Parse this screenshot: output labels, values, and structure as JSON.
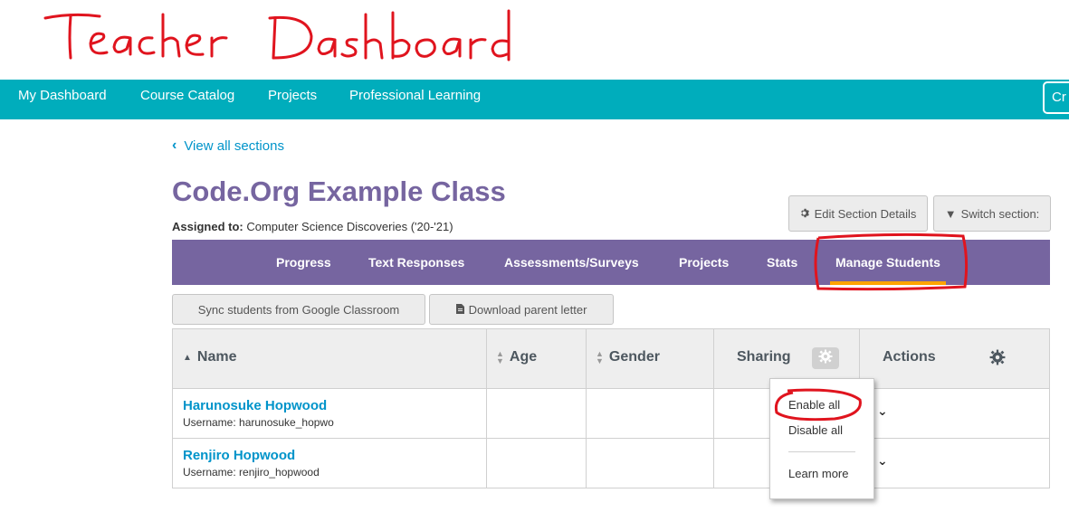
{
  "annotation": {
    "title": "Teacher Dashboard"
  },
  "topnav": {
    "items": [
      "My Dashboard",
      "Course Catalog",
      "Projects",
      "Professional Learning"
    ],
    "create_button": "Cr"
  },
  "back_link": "View all sections",
  "section": {
    "title": "Code.Org Example Class",
    "assigned_label": "Assigned to:",
    "assigned_value": "Computer Science Discoveries ('20-'21)"
  },
  "header_buttons": {
    "edit": "Edit Section Details",
    "switch": "Switch section:"
  },
  "tabs": [
    "Progress",
    "Text Responses",
    "Assessments/Surveys",
    "Projects",
    "Stats",
    "Manage Students"
  ],
  "active_tab": "Manage Students",
  "toolbar": {
    "sync": "Sync students from Google Classroom",
    "download": "Download parent letter"
  },
  "table": {
    "columns": [
      "Name",
      "Age",
      "Gender",
      "Sharing",
      "Actions"
    ],
    "rows": [
      {
        "name": "Harunosuke Hopwood",
        "username": "Username: harunosuke_hopwo"
      },
      {
        "name": "Renjiro Hopwood",
        "username": "Username: renjiro_hopwood"
      }
    ]
  },
  "sharing_menu": [
    "Enable all",
    "Disable all",
    "Learn more"
  ],
  "colors": {
    "nav": "#00adbc",
    "tabs": "#7665a0",
    "link": "#0094ca",
    "annotation": "#e0141e",
    "active_underline": "#ffa400"
  }
}
